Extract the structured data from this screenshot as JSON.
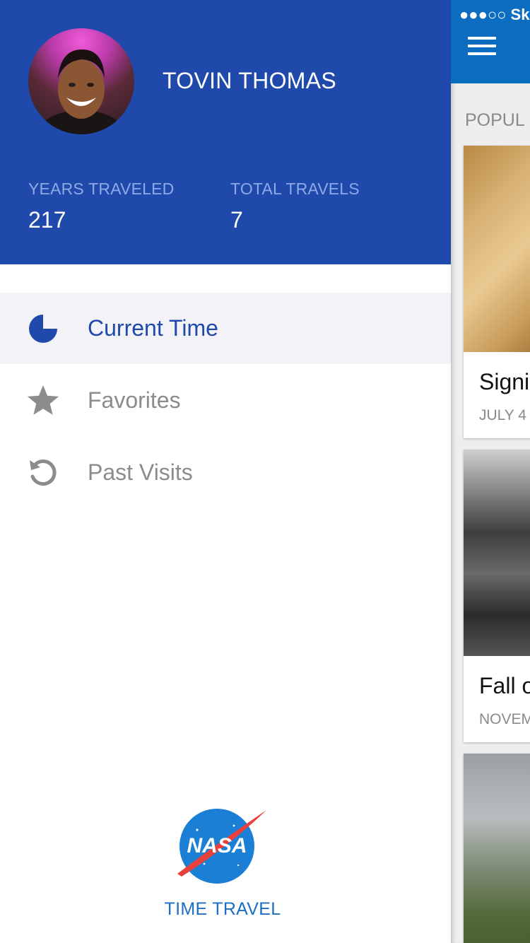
{
  "profile": {
    "name": "TOVIN THOMAS",
    "stats": [
      {
        "label": "YEARS TRAVELED",
        "value": "217"
      },
      {
        "label": "TOTAL TRAVELS",
        "value": "7"
      }
    ]
  },
  "menu": {
    "items": [
      {
        "label": "Current Time",
        "icon": "pie-clock-icon",
        "active": true
      },
      {
        "label": "Favorites",
        "icon": "star-icon",
        "active": false
      },
      {
        "label": "Past Visits",
        "icon": "history-icon",
        "active": false
      }
    ]
  },
  "brand": {
    "logo_text": "NASA",
    "tagline": "TIME TRAVEL"
  },
  "main_screen": {
    "status_bar": "●●●○○ Sk",
    "section_title": "POPUL",
    "cards": [
      {
        "title": "Signi",
        "date": "JULY 4"
      },
      {
        "title": "Fall o",
        "date": "NOVEM"
      }
    ]
  },
  "colors": {
    "primary": "#1f4aab",
    "header_blue": "#0b6cc0",
    "stat_label": "#8ea9e6",
    "inactive_text": "#8c8c8c",
    "active_bg": "#f3f3f7"
  }
}
